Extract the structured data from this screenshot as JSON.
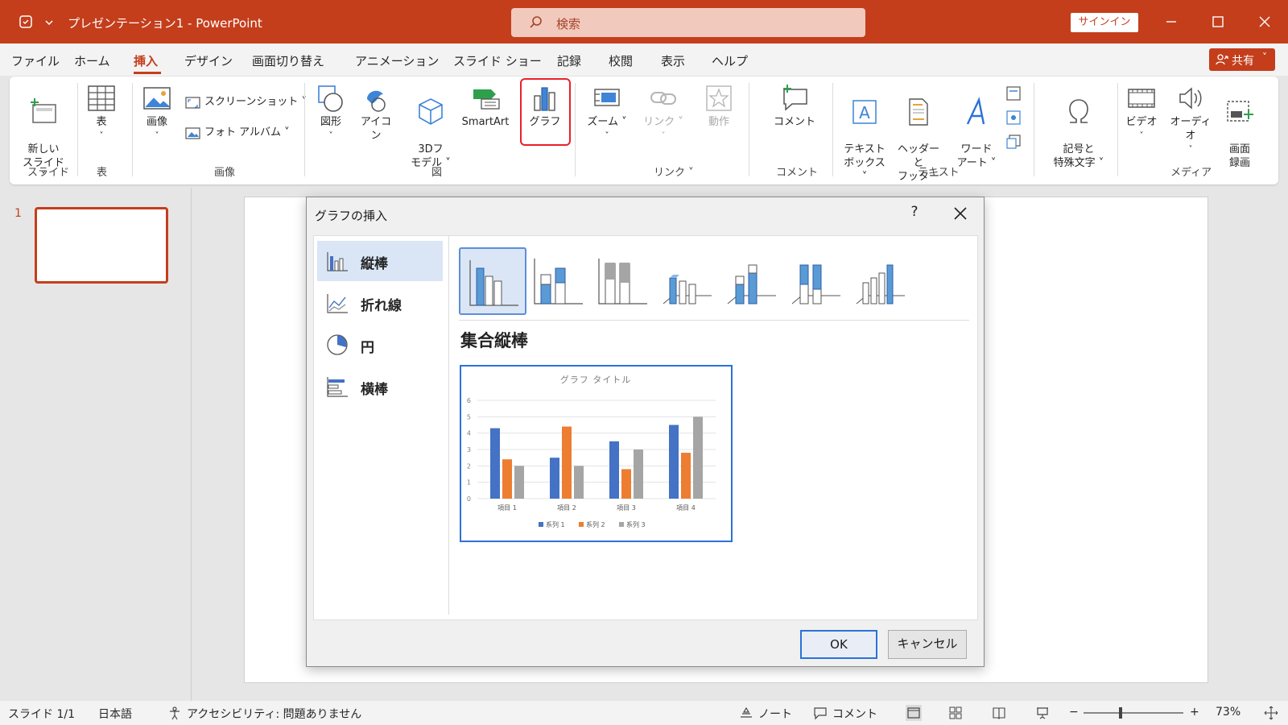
{
  "titlebar": {
    "title": "プレゼンテーション1  -  PowerPoint",
    "search_placeholder": "検索",
    "signin_label": "サインイン"
  },
  "menu": {
    "items": [
      "ファイル",
      "ホーム",
      "挿入",
      "デザイン",
      "画面切り替え",
      "アニメーション",
      "スライド ショー",
      "記録",
      "校閲",
      "表示",
      "ヘルプ"
    ],
    "active": "挿入",
    "share_label": "共有"
  },
  "ribbon": {
    "new_slide": "新しい\nスライド ˅",
    "table": "表",
    "images": "画像",
    "screenshot": "スクリーンショット ˅",
    "photo_album": "フォト アルバム  ˅",
    "shapes": "図形",
    "icons": "アイコン",
    "model3d": "3Dフ\nモデル ˅",
    "smartart": "SmartArt",
    "chart": "グラフ",
    "zoom": "ズーム ˅",
    "link": "リンク ˅",
    "action": "動作",
    "comment": "コメント",
    "textbox": "テキスト\nボックス ˅",
    "header_footer": "ヘッダーと\nフッター",
    "wordart": "ワード\nアート ˅",
    "symbols": "記号と\n特殊文字 ˅",
    "video": "ビデオ",
    "audio": "オーディオ",
    "screen_recording": "画面\n録画",
    "groups": {
      "slides": "スライド",
      "tables": "表",
      "images": "画像",
      "illustrations": "図",
      "links": "リンク ˅",
      "comments": "コメント",
      "text": "テキスト",
      "media": "メディア"
    }
  },
  "slides_pane": {
    "slide_number": "1"
  },
  "dialog": {
    "title": "グラフの挿入",
    "help": "?",
    "categories": [
      {
        "label": "縦棒",
        "selected": true
      },
      {
        "label": "折れ線",
        "selected": false
      },
      {
        "label": "円",
        "selected": false
      },
      {
        "label": "横棒",
        "selected": false
      }
    ],
    "subtype_name": "集合縦棒",
    "ok_label": "OK",
    "cancel_label": "キャンセル"
  },
  "chart_data": {
    "type": "bar",
    "title": "グラフ タイトル",
    "categories": [
      "項目 1",
      "項目 2",
      "項目 3",
      "項目 4"
    ],
    "series": [
      {
        "name": "系列 1",
        "values": [
          4.3,
          2.5,
          3.5,
          4.5
        ],
        "color": "#4472c4"
      },
      {
        "name": "系列 2",
        "values": [
          2.4,
          4.4,
          1.8,
          2.8
        ],
        "color": "#ed7d31"
      },
      {
        "name": "系列 3",
        "values": [
          2,
          2,
          3,
          5
        ],
        "color": "#a5a5a5"
      }
    ],
    "ylim": [
      0,
      6
    ],
    "yticks": [
      0,
      1,
      2,
      3,
      4,
      5,
      6
    ],
    "grid": true,
    "legend": "bottom"
  },
  "statusbar": {
    "slide": "スライド 1/1",
    "language": "日本語",
    "accessibility": "アクセシビリティ: 問題ありません",
    "notes": "ノート",
    "comments": "コメント",
    "zoom": "73%"
  },
  "colors": {
    "accent": "#c43e1c",
    "highlight": "#e8212b",
    "dialog_accent": "#2b72d9"
  }
}
